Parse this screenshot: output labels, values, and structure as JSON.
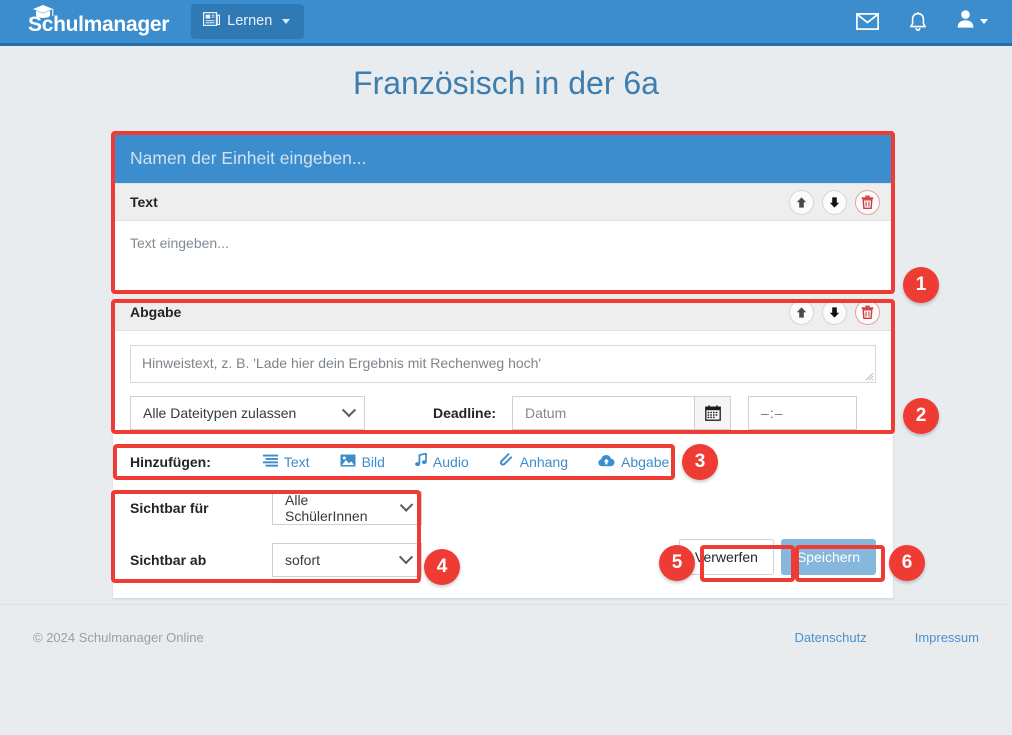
{
  "navbar": {
    "brand": "Schulmanager",
    "brand_icon": "graduation-cap-icon",
    "menu_button": {
      "label": "Lernen",
      "icon": "newspaper-icon"
    },
    "mail_icon": "envelope-icon",
    "bell_icon": "bell-icon",
    "user_icon": "user-icon"
  },
  "page": {
    "title": "Französisch in der 6a"
  },
  "unit": {
    "title_placeholder": "Namen der Einheit eingeben..."
  },
  "blocks": {
    "text": {
      "heading": "Text",
      "body_placeholder": "Text eingeben...",
      "tools": {
        "up": "arrow-up-icon",
        "down": "arrow-down-icon",
        "delete": "trash-icon"
      }
    },
    "abgabe": {
      "heading": "Abgabe",
      "hint_placeholder": "Hinweistext, z. B. 'Lade hier dein Ergebnis mit Rechenweg hoch'",
      "filetypes_value": "Alle Dateitypen zulassen",
      "deadline_label": "Deadline:",
      "date_placeholder": "Datum",
      "date_button_icon": "calendar-icon",
      "time_value": "–:–",
      "tools": {
        "up": "arrow-up-icon",
        "down": "arrow-down-icon",
        "delete": "trash-icon"
      }
    }
  },
  "add_row": {
    "label": "Hinzufügen:",
    "items": [
      {
        "label": "Text",
        "icon": "text-lines-icon"
      },
      {
        "label": "Bild",
        "icon": "image-icon"
      },
      {
        "label": "Audio",
        "icon": "music-note-icon"
      },
      {
        "label": "Anhang",
        "icon": "paperclip-icon"
      },
      {
        "label": "Abgabe",
        "icon": "cloud-upload-icon"
      }
    ]
  },
  "visibility": {
    "for_label": "Sichtbar für",
    "for_value": "Alle SchülerInnen",
    "from_label": "Sichtbar ab",
    "from_value": "sofort"
  },
  "actions": {
    "discard": "Verwerfen",
    "save": "Speichern"
  },
  "footer": {
    "copyright": "© 2024 Schulmanager Online",
    "privacy": "Datenschutz",
    "imprint": "Impressum"
  },
  "annotations": {
    "badges": [
      "1",
      "2",
      "3",
      "4",
      "5",
      "6"
    ]
  },
  "colors": {
    "brand_blue": "#3c8dcd",
    "annotation_red": "#ee3b33",
    "page_bg": "#e9ecef",
    "title_blue": "#3d7eae",
    "save_blue": "#86b7dd"
  }
}
